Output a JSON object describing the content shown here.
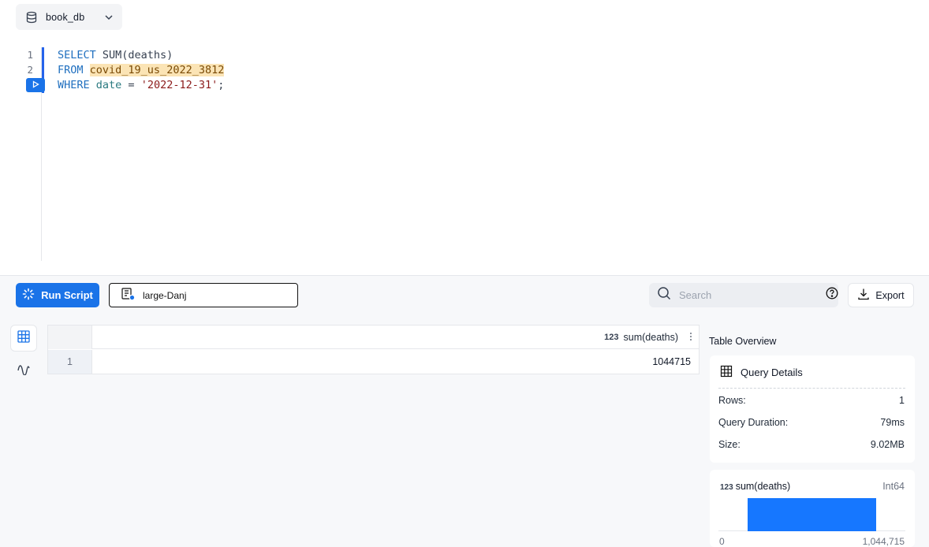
{
  "db_selector": {
    "label": "book_db",
    "icon": "database-icon"
  },
  "editor": {
    "line_numbers": [
      "1",
      "2"
    ],
    "lines": [
      {
        "keyword": "SELECT",
        "text": " SUM(deaths)"
      },
      {
        "keyword": "FROM",
        "table": "covid_19_us_2022_3812"
      },
      {
        "keyword": "WHERE",
        "column": "date",
        "op": " = ",
        "string": "'2022-12-31'",
        "end": ";"
      }
    ]
  },
  "toolbar": {
    "run_label": "Run Script",
    "connection_label": "large-Danj",
    "search_placeholder": "Search",
    "export_label": "Export"
  },
  "grid": {
    "column": {
      "type": "123",
      "name": "sum(deaths)"
    },
    "rows": [
      {
        "num": "1",
        "value": "1044715"
      }
    ]
  },
  "overview": {
    "title": "Table Overview",
    "query_details": {
      "title": "Query Details",
      "rows_label": "Rows:",
      "rows_value": "1",
      "duration_label": "Query Duration:",
      "duration_value": "79ms",
      "size_label": "Size:",
      "size_value": "9.02MB"
    },
    "column_stats": {
      "type_badge": "123",
      "name": "sum(deaths)",
      "dtype": "Int64",
      "min": "0",
      "max": "1,044,715",
      "histogram_fill": 1.0
    }
  },
  "colors": {
    "accent": "#1a73e8",
    "histogram": "#1677ff",
    "table_highlight": "#fbe4b5"
  }
}
